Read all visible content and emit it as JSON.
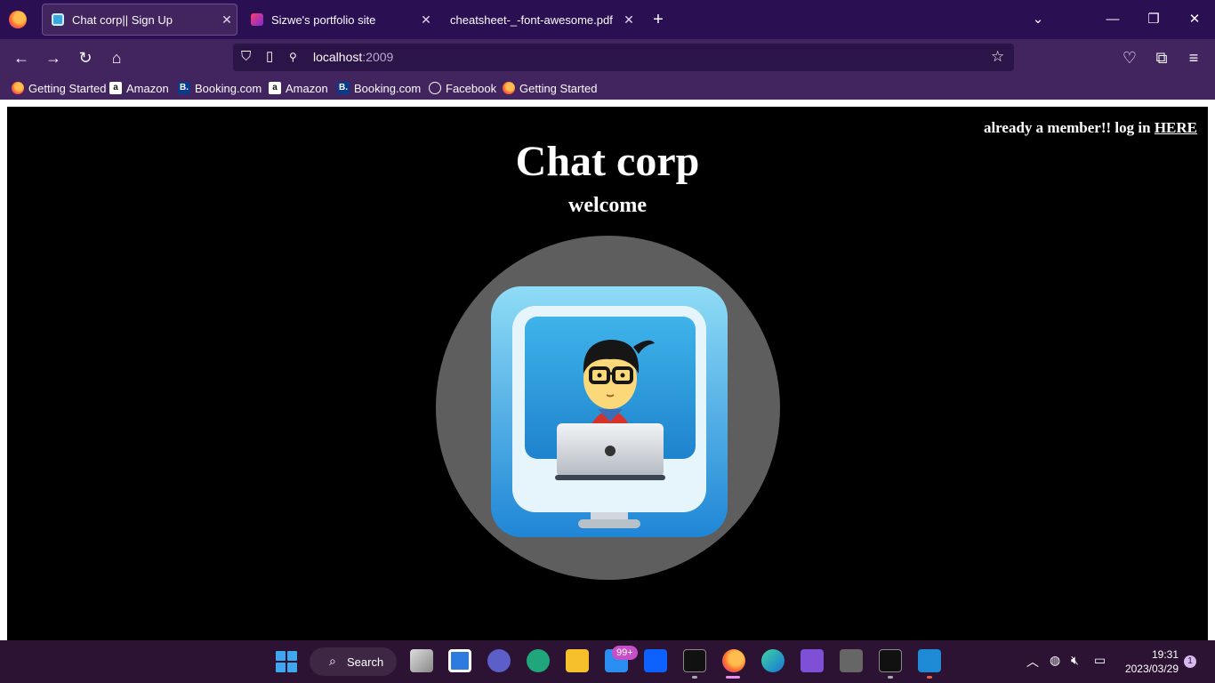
{
  "browser": {
    "tabs": [
      {
        "title": "Chat corp|| Sign Up",
        "active": true,
        "favicon": "chat-favicon"
      },
      {
        "title": "Sizwe's portfolio site",
        "active": false,
        "favicon": "portfolio-favicon"
      },
      {
        "title": "cheatsheet-_-font-awesome.pdf",
        "active": false,
        "favicon": "none"
      }
    ],
    "url_host": "localhost",
    "url_port": ":2009",
    "bookmarks": [
      {
        "label": "Getting Started",
        "icon": "firefox-icon"
      },
      {
        "label": "Amazon",
        "icon": "amazon-icon"
      },
      {
        "label": "Booking.com",
        "icon": "booking-icon"
      },
      {
        "label": "Amazon",
        "icon": "amazon-icon"
      },
      {
        "label": "Booking.com",
        "icon": "booking-icon"
      },
      {
        "label": "Facebook",
        "icon": "globe-icon"
      },
      {
        "label": "Getting Started",
        "icon": "firefox-icon"
      }
    ],
    "theme_color": "#42245f"
  },
  "page": {
    "login_prefix": "already a member!! log in ",
    "login_link": "HERE",
    "title": "Chat corp",
    "subtitle": "welcome"
  },
  "taskbar": {
    "search_label": "Search",
    "mail_badge": "99+",
    "time": "19:31",
    "date": "2023/03/29",
    "notifications": "1"
  }
}
